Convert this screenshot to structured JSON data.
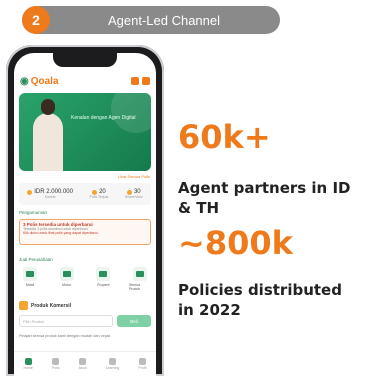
{
  "header": {
    "step_number": "2",
    "title": "Agent-Led Channel"
  },
  "phone": {
    "app_logo": "Qoala",
    "banner_text": "Kenalan dengan Agen Digital",
    "see_more": "Lihat Semua Polis",
    "stats": [
      {
        "value": "IDR 2.000.000",
        "label": "Komisi"
      },
      {
        "value": "20",
        "label": "Polis Terjual"
      },
      {
        "value": "30",
        "label": "Share/View"
      }
    ],
    "section_notice_title": "Pengumuman",
    "notice_title": "3 Polis tersedia untuk diperbarui",
    "notice_subtitle": "Tersedia 3 polis asuransi untuk diperbarui",
    "notice_link": "Klik disini untuk lihat polis yang dapat diperbarui.",
    "section_products_title": "Jual Perusahaan",
    "products": [
      "Mobil",
      "Motor",
      "Properti",
      "Semua Produk"
    ],
    "calculator_title": "Produk Komersil",
    "select_placeholder": "Pilih Produk",
    "calculate_button": "Beli",
    "learn_text": "Pelajari semua produk kami dengan mudah dan cepat.",
    "bottom_nav": [
      "Home",
      "Polis",
      "Akun",
      "Learning",
      "Profil"
    ]
  },
  "metrics": [
    {
      "value": "60k+",
      "line1": "Agent partners in ID",
      "line2": "& TH"
    },
    {
      "value": "~800k",
      "line1": "Policies distributed",
      "line2": "in 2022"
    }
  ],
  "colors": {
    "accent": "#ee7a1c",
    "pill": "#8a8a8a",
    "brand_green": "#2a8f5c"
  }
}
